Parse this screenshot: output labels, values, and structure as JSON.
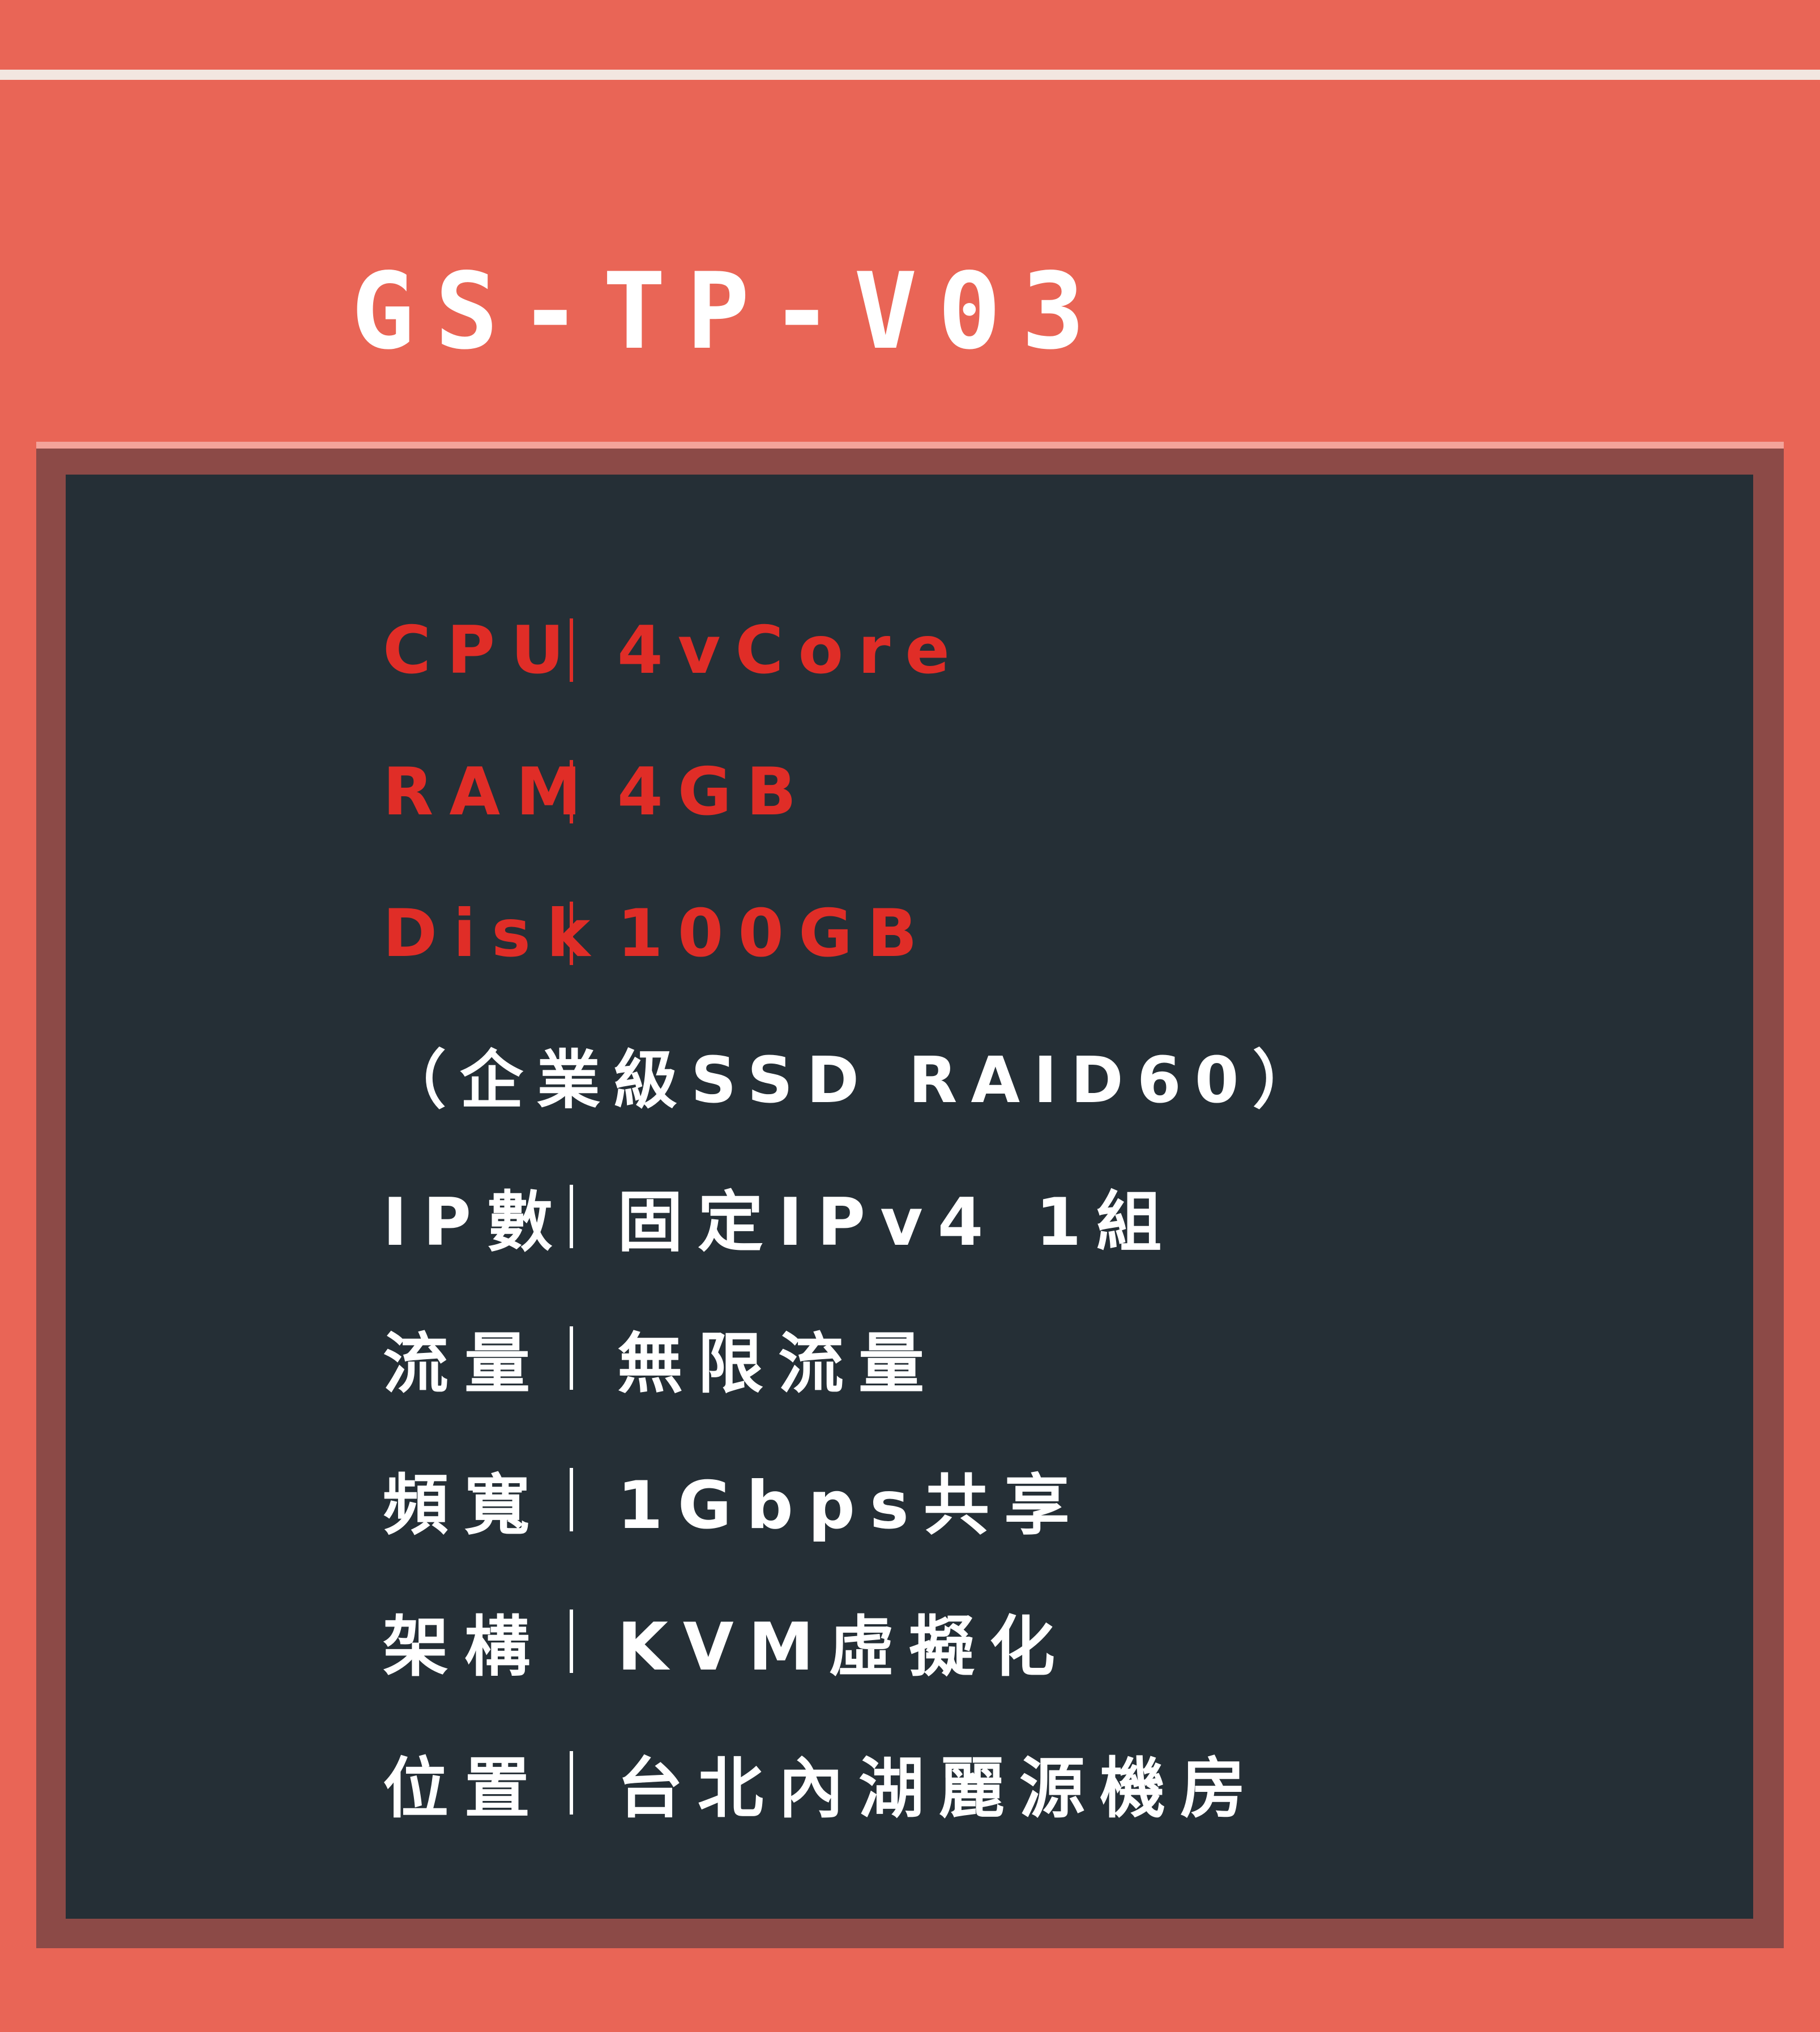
{
  "title": "GS-TP-V03",
  "colors": {
    "background": "#e96556",
    "panel": "#252f36",
    "frame": "#8c4a47",
    "highlight_text": "#e02d27",
    "text": "#ffffff"
  },
  "specs": [
    {
      "label": "CPU",
      "value": "4vCore"
    },
    {
      "label": "RAM",
      "value": "4GB"
    },
    {
      "label": "Disk",
      "value": "100GB"
    },
    {
      "note": "（企業級SSD RAID60）"
    },
    {
      "label": "IP數",
      "value": "固定IPv4 1組"
    },
    {
      "label": "流量",
      "value": "無限流量"
    },
    {
      "label": "頻寬",
      "value": "1Gbps共享"
    },
    {
      "label": "架構",
      "value": "KVM虛擬化"
    },
    {
      "label": "位置",
      "value": "台北內湖麗源機房"
    }
  ]
}
